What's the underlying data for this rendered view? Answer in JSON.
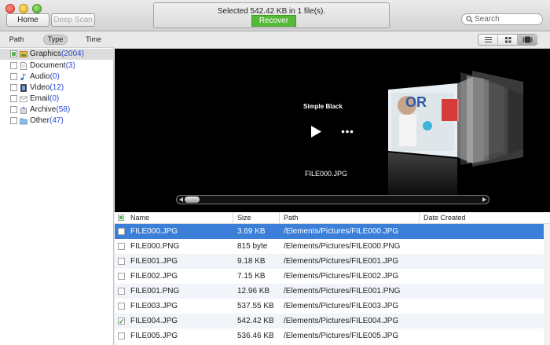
{
  "toolbar": {
    "home_label": "Home",
    "deep_scan_label": "Deep Scan",
    "status_text": "Selected 542.42 KB in 1 file(s).",
    "recover_label": "Recover",
    "search_placeholder": "Search"
  },
  "filter_tabs": [
    "Path",
    "Type",
    "Time"
  ],
  "active_filter": "Type",
  "categories": [
    {
      "label": "Graphics",
      "count": "(2004)",
      "icon": "graphics-icon",
      "selected": true
    },
    {
      "label": "Document",
      "count": "(3)",
      "icon": "document-icon"
    },
    {
      "label": "Audio",
      "count": "(0)",
      "icon": "audio-icon"
    },
    {
      "label": "Video",
      "count": "(12)",
      "icon": "video-icon"
    },
    {
      "label": "Email",
      "count": "(0)",
      "icon": "email-icon"
    },
    {
      "label": "Archive",
      "count": "(58)",
      "icon": "archive-icon"
    },
    {
      "label": "Other",
      "count": "(47)",
      "icon": "folder-icon"
    }
  ],
  "view_modes": [
    "list-view-icon",
    "grid-view-icon",
    "coverflow-view-icon"
  ],
  "preview": {
    "title": "Simple Black",
    "file_name": "FILE000.JPG"
  },
  "table": {
    "columns": [
      "Name",
      "Size",
      "Path",
      "Date Created"
    ],
    "rows": [
      {
        "name": "FILE000.JPG",
        "size": "3.69 KB",
        "path": "/Elements/Pictures/FILE000.JPG",
        "checked": false,
        "selected": true
      },
      {
        "name": "FILE000.PNG",
        "size": "815 byte",
        "path": "/Elements/Pictures/FILE000.PNG",
        "checked": false
      },
      {
        "name": "FILE001.JPG",
        "size": "9.18 KB",
        "path": "/Elements/Pictures/FILE001.JPG",
        "checked": false
      },
      {
        "name": "FILE002.JPG",
        "size": "7.15 KB",
        "path": "/Elements/Pictures/FILE002.JPG",
        "checked": false
      },
      {
        "name": "FILE001.PNG",
        "size": "12.96 KB",
        "path": "/Elements/Pictures/FILE001.PNG",
        "checked": false
      },
      {
        "name": "FILE003.JPG",
        "size": "537.55 KB",
        "path": "/Elements/Pictures/FILE003.JPG",
        "checked": false
      },
      {
        "name": "FILE004.JPG",
        "size": "542.42 KB",
        "path": "/Elements/Pictures/FILE004.JPG",
        "checked": true
      },
      {
        "name": "FILE005.JPG",
        "size": "536.46 KB",
        "path": "/Elements/Pictures/FILE005.JPG",
        "checked": false
      }
    ]
  },
  "colors": {
    "recover_green": "#54b936",
    "selection_blue": "#3b7fd8",
    "count_blue": "#2a4bd7"
  }
}
